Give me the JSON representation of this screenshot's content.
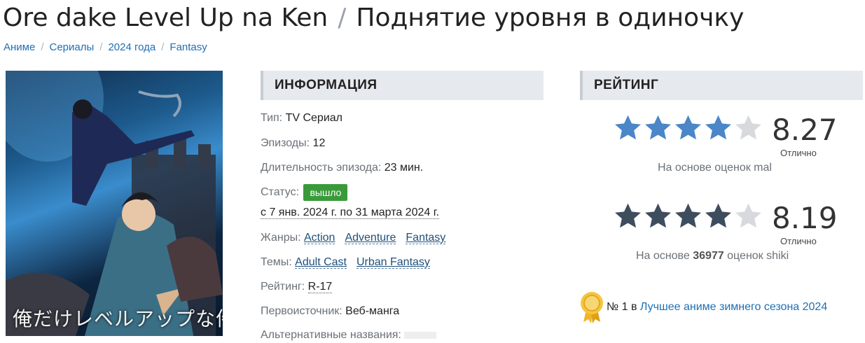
{
  "title": {
    "romaji": "Ore dake Level Up na Ken",
    "separator": "/",
    "russian": "Поднятие уровня в одиночку"
  },
  "breadcrumbs": [
    {
      "label": "Аниме"
    },
    {
      "label": "Сериалы"
    },
    {
      "label": "2024 года"
    },
    {
      "label": "Fantasy"
    }
  ],
  "poster": {
    "caption": "俺だけレベルアップな件"
  },
  "info": {
    "header": "ИНФОРМАЦИЯ",
    "type_label": "Тип:",
    "type_value": "TV Сериал",
    "episodes_label": "Эпизоды:",
    "episodes_value": "12",
    "duration_label": "Длительность эпизода:",
    "duration_value": "23 мин.",
    "status_label": "Статус:",
    "status_value": "вышло",
    "aired": "с 7 янв. 2024 г. по 31 марта 2024 г.",
    "genres_label": "Жанры:",
    "genres": [
      "Action",
      "Adventure",
      "Fantasy"
    ],
    "themes_label": "Темы:",
    "themes": [
      "Adult Cast",
      "Urban Fantasy"
    ],
    "rating_label": "Рейтинг:",
    "rating_value": "R-17",
    "source_label": "Первоисточник:",
    "source_value": "Веб-манга",
    "alt_names_label": "Альтернативные названия:"
  },
  "rating": {
    "header": "РЕЙТИНГ",
    "mal": {
      "score": "8.27",
      "stars_filled": 4,
      "stars_total": 5,
      "verdict": "Отлично",
      "based_text": "На основе оценок mal",
      "star_color": "#4a86c8"
    },
    "shiki": {
      "score": "8.19",
      "stars_filled": 4,
      "stars_total": 5,
      "verdict": "Отлично",
      "based_prefix": "На основе",
      "based_count": "36977",
      "based_suffix": "оценок shiki",
      "star_color": "#3e4d5e"
    }
  },
  "award": {
    "icon": "medal-icon",
    "prefix": "№ 1 в",
    "link": "Лучшее аниме зимнего сезона 2024",
    "color": "#f0b429"
  }
}
